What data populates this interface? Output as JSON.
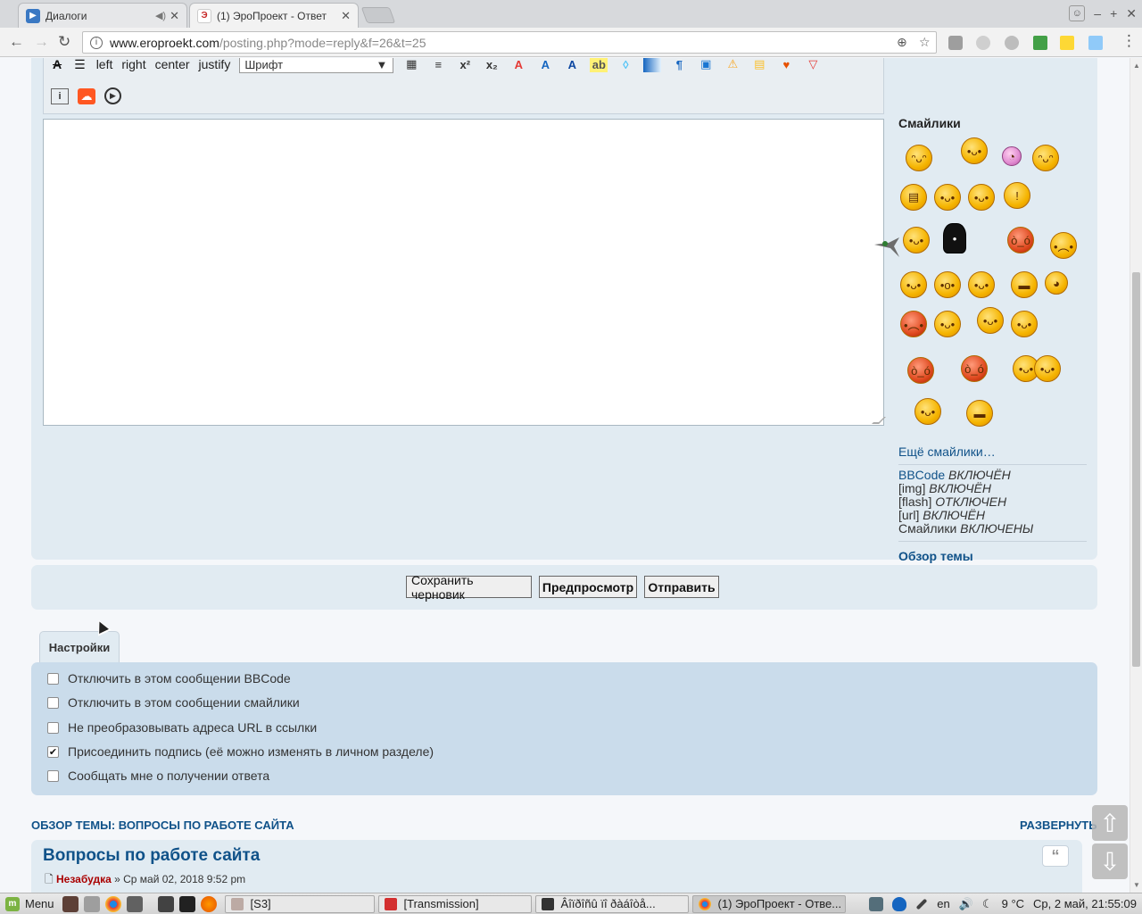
{
  "browser": {
    "tabs": [
      {
        "title": "Диалоги"
      },
      {
        "title": "(1) ЭроПроект - Ответ"
      }
    ],
    "url_host": "www.eroproekt.com",
    "url_path": "/posting.php?mode=reply&f=26&t=25"
  },
  "editor": {
    "align_buttons": [
      "left",
      "right",
      "center",
      "justify"
    ],
    "font_select": "Шрифт",
    "textarea_value": ""
  },
  "smilies": {
    "heading": "Смайлики",
    "more_link": "Ещё смайлики…",
    "status": [
      {
        "label": "BBCode",
        "value": "ВКЛЮЧЁН",
        "linked": true
      },
      {
        "label": "[img]",
        "value": "ВКЛЮЧЁН",
        "linked": false
      },
      {
        "label": "[flash]",
        "value": "ОТКЛЮЧЕН",
        "linked": false
      },
      {
        "label": "[url]",
        "value": "ВКЛЮЧЁН",
        "linked": false
      },
      {
        "label": "Смайлики",
        "value": "ВКЛЮЧЕНЫ",
        "linked": false
      }
    ],
    "topic_review_link": "Обзор темы"
  },
  "buttons": {
    "save_draft": "Сохранить черновик",
    "preview": "Предпросмотр",
    "submit": "Отправить"
  },
  "options": {
    "tab_label": "Настройки",
    "items": [
      {
        "label": "Отключить в этом сообщении BBCode",
        "checked": false
      },
      {
        "label": "Отключить в этом сообщении смайлики",
        "checked": false
      },
      {
        "label": "Не преобразовывать адреса URL в ссылки",
        "checked": false
      },
      {
        "label": "Присоединить подпись (её можно изменять в личном разделе)",
        "checked": true
      },
      {
        "label": "Сообщать мне о получении ответа",
        "checked": false
      }
    ]
  },
  "review": {
    "heading": "ОБЗОР ТЕМЫ: ВОПРОСЫ ПО РАБОТЕ САЙТА",
    "expand": "РАЗВЕРНУТЬ",
    "post_title": "Вопросы по работе сайта",
    "author": "Незабудка",
    "date": "» Ср май 02, 2018 9:52 pm",
    "quote_icon": "“"
  },
  "taskbar": {
    "menu_label": "Menu",
    "tasks": [
      "[S3]",
      "[Transmission]",
      "Âîïðîñû ïî ðàáîòå...",
      "(1) ЭроПроект - Отве..."
    ],
    "lang": "en",
    "weather": "9 °C",
    "datetime": "Ср, 2 май, 21:55:09"
  },
  "colors": {
    "link": "#105289",
    "panel": "#e1ebf2",
    "options_panel": "#cadceb",
    "author": "#aa0000"
  }
}
